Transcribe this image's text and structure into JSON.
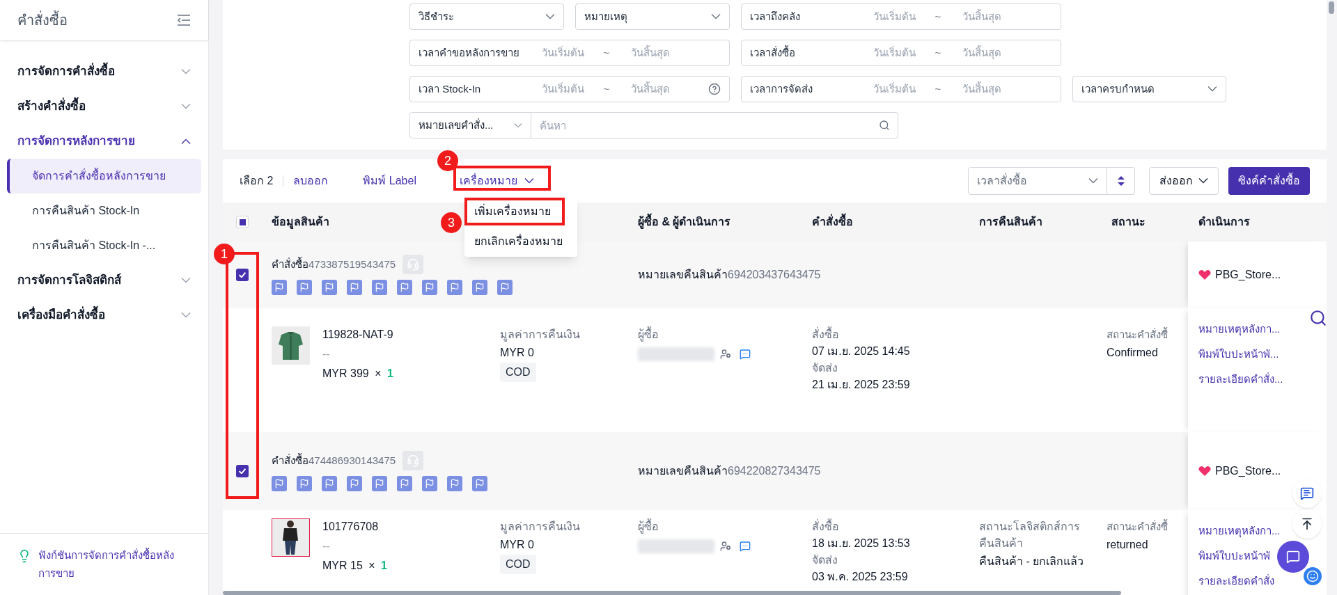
{
  "sidebar": {
    "title": "คำสั่งซื้อ",
    "items": [
      {
        "label": "การจัดการคำสั่งซื้อ",
        "expanded": false
      },
      {
        "label": "สร้างคำสั่งซื้อ",
        "expanded": false
      },
      {
        "label": "การจัดการหลังการขาย",
        "expanded": true,
        "children": [
          {
            "label": "จัดการคำสั่งซื้อหลังการขาย",
            "selected": true
          },
          {
            "label": "การคืนสินค้า Stock-In",
            "selected": false
          },
          {
            "label": "การคืนสินค้า Stock-In -...",
            "selected": false
          }
        ]
      },
      {
        "label": "การจัดการโลจิสติกส์",
        "expanded": false
      },
      {
        "label": "เครื่องมือคำสั่งซื้อ",
        "expanded": false
      }
    ],
    "footer_tip": "ฟังก์ชันการจัดการคำสั่งซื้อหลังการขาย"
  },
  "filters": [
    [
      {
        "kind": "select",
        "label": "วิธีชำระ"
      },
      {
        "kind": "select",
        "label": "หมายเหตุ"
      },
      {
        "kind": "date_range",
        "label": "เวลาถึงคลัง",
        "start": "วันเริ่มต้น",
        "end": "วันสิ้นสุด",
        "sep": "~"
      }
    ],
    [
      {
        "kind": "date_range",
        "label": "เวลาคำขอหลังการขาย",
        "start": "วันเริ่มต้น",
        "end": "วันสิ้นสุด",
        "sep": "~"
      },
      {
        "kind": "date_range",
        "label": "เวลาสั่งซื้อ",
        "start": "วันเริ่มต้น",
        "end": "วันสิ้นสุด",
        "sep": "~"
      }
    ],
    [
      {
        "kind": "date_range",
        "label": "เวลา Stock-In",
        "start": "วันเริ่มต้น",
        "end": "วันสิ้นสุด",
        "sep": "~",
        "help": true
      },
      {
        "kind": "date_range",
        "label": "เวลาการจัดส่ง",
        "start": "วันเริ่มต้น",
        "end": "วันสิ้นสุด",
        "sep": "~"
      },
      {
        "kind": "select",
        "label": "เวลาครบกำหนด"
      }
    ],
    [
      {
        "kind": "search",
        "label": "หมายเลขคำสั่ง...",
        "placeholder": "ค้นหา"
      }
    ]
  ],
  "toolbar": {
    "selected_count": "เลือก 2",
    "delete": "ลบออก",
    "print": "พิมพ์ Label",
    "mark": "เครื่องหมาย",
    "mark_menu": [
      "เพิ่มเครื่องหมาย",
      "ยกเลิกเครื่องหมาย"
    ],
    "sort": "เวลาสั่งซื้อ",
    "export": "ส่งออก",
    "sync": "ซิงค์คำสั่งซื้อ"
  },
  "table": {
    "select_all_indeterminate": true,
    "columns": [
      {
        "label": "ข้อมูลสินค้า"
      },
      {
        "label": "ผู้ซื้อ & ผู้ดำเนินการ"
      },
      {
        "label": "คำสั่งซื้อ"
      },
      {
        "label": "การคืนสินค้า"
      },
      {
        "label": "สถานะ"
      },
      {
        "label": "ดำเนินการ"
      }
    ],
    "rows": [
      {
        "checked": true,
        "order_label": "คำสั่งซื้อ",
        "order_no": "473387519543475",
        "flags": [
          {
            "kind": "flag"
          },
          {
            "kind": "flag"
          },
          {
            "kind": "flag"
          },
          {
            "kind": "flag"
          },
          {
            "kind": "flag"
          },
          {
            "kind": "flag"
          },
          {
            "kind": "flag"
          },
          {
            "kind": "flag"
          },
          {
            "kind": "flag"
          },
          {
            "kind": "flag"
          }
        ],
        "return_label": "หมายเลขคืนสินค้า",
        "return_no": "694203437643475",
        "store": "PBG_Store...",
        "product": {
          "sku": "119828-NAT-9",
          "variant": "--",
          "price": "MYR 399",
          "times": "×",
          "qty": "1"
        },
        "refund": {
          "label": "มูลค่าการคืนเงิน",
          "amount": "MYR 0",
          "method": "COD"
        },
        "buyer_label": "ผู้ซื้อ",
        "times": [
          {
            "label": "สั่งซื้อ",
            "value": "07 เม.ย. 2025 14:45"
          },
          {
            "label": "จัดส่ง",
            "value": "21 เม.ย. 2025 23:59"
          }
        ],
        "status": {
          "label": "สถานะคำสั่งซื้",
          "value": "Confirmed"
        },
        "actions": [
          "หมายเหตุหลังกา...",
          "พิมพ์ใบปะหน้าพั...",
          "รายละเอียดคำสั่ง..."
        ]
      },
      {
        "checked": true,
        "order_label": "คำสั่งซื้อ",
        "order_no": "474486930143475",
        "flags": [
          {
            "kind": "flag"
          },
          {
            "kind": "flag"
          },
          {
            "kind": "flag"
          },
          {
            "kind": "flag"
          },
          {
            "kind": "flag"
          },
          {
            "kind": "flag"
          },
          {
            "kind": "flag"
          },
          {
            "kind": "flag"
          },
          {
            "kind": "flag"
          }
        ],
        "return_label": "หมายเลขคืนสินค้า",
        "return_no": "694220827343475",
        "store": "PBG_Store...",
        "product": {
          "sku": "101776708",
          "variant": "--",
          "price": "MYR 15",
          "times": "×",
          "qty": "1"
        },
        "refund": {
          "label": "มูลค่าการคืนเงิน",
          "amount": "MYR 0",
          "method": "COD"
        },
        "buyer_label": "ผู้ซื้อ",
        "times": [
          {
            "label": "สั่งซื้อ",
            "value": "18 เม.ย. 2025 13:53"
          },
          {
            "label": "จัดส่ง",
            "value": "03 พ.ค. 2025 23:59"
          }
        ],
        "return_status": {
          "label": "สถานะโลจิสติกส์การคืนสินค้า",
          "value": "คืนสินค้า - ยกเลิกแล้ว"
        },
        "status": {
          "label": "สถานะคำสั่งซื้",
          "value": "returned"
        },
        "actions": [
          "หมายเหตุหลังกา...",
          "พิมพ์ใบปะหน้าพั",
          "รายละเอียดคำสั่ง"
        ]
      }
    ]
  },
  "annotations": [
    {
      "number": "1"
    },
    {
      "number": "2"
    },
    {
      "number": "3"
    }
  ]
}
